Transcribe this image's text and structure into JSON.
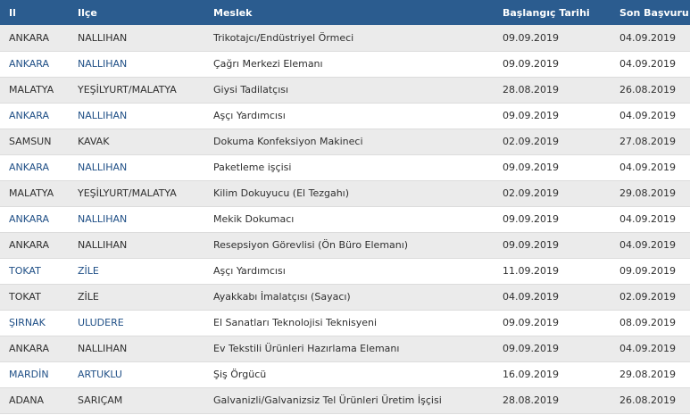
{
  "headers": {
    "il": "Il",
    "ilce": "Ilçe",
    "meslek": "Meslek",
    "baslangic": "Başlangıç Tarihi",
    "son_basvuru": "Son Başvuru"
  },
  "colors": {
    "header_bg": "#2b5c8f",
    "row_alt_bg": "#ebebeb",
    "link_blue": "#1f4f86",
    "text_dark": "#2f2f2f"
  },
  "rows": [
    {
      "il": "ANKARA",
      "ilce": "NALLIHAN",
      "meslek": "Trikotajcı/Endüstriyel Örmeci",
      "baslangic": "09.09.2019",
      "son": "04.09.2019"
    },
    {
      "il": "ANKARA",
      "ilce": "NALLIHAN",
      "meslek": "Çağrı Merkezi Elemanı",
      "baslangic": "09.09.2019",
      "son": "04.09.2019"
    },
    {
      "il": "MALATYA",
      "ilce": "YEŞİLYURT/MALATYA",
      "meslek": "Giysi Tadilatçısı",
      "baslangic": "28.08.2019",
      "son": "26.08.2019"
    },
    {
      "il": "ANKARA",
      "ilce": "NALLIHAN",
      "meslek": "Aşçı Yardımcısı",
      "baslangic": "09.09.2019",
      "son": "04.09.2019"
    },
    {
      "il": "SAMSUN",
      "ilce": "KAVAK",
      "meslek": "Dokuma Konfeksiyon Makineci",
      "baslangic": "02.09.2019",
      "son": "27.08.2019"
    },
    {
      "il": "ANKARA",
      "ilce": "NALLIHAN",
      "meslek": "Paketleme işçisi",
      "baslangic": "09.09.2019",
      "son": "04.09.2019"
    },
    {
      "il": "MALATYA",
      "ilce": "YEŞİLYURT/MALATYA",
      "meslek": "Kilim Dokuyucu (El Tezgahı)",
      "baslangic": "02.09.2019",
      "son": "29.08.2019"
    },
    {
      "il": "ANKARA",
      "ilce": "NALLIHAN",
      "meslek": "Mekik Dokumacı",
      "baslangic": "09.09.2019",
      "son": "04.09.2019"
    },
    {
      "il": "ANKARA",
      "ilce": "NALLIHAN",
      "meslek": "Resepsiyon Görevlisi (Ön Büro Elemanı)",
      "baslangic": "09.09.2019",
      "son": "04.09.2019"
    },
    {
      "il": "TOKAT",
      "ilce": "ZİLE",
      "meslek": "Aşçı Yardımcısı",
      "baslangic": "11.09.2019",
      "son": "09.09.2019"
    },
    {
      "il": "TOKAT",
      "ilce": "ZİLE",
      "meslek": "Ayakkabı İmalatçısı (Sayacı)",
      "baslangic": "04.09.2019",
      "son": "02.09.2019"
    },
    {
      "il": "ŞIRNAK",
      "ilce": "ULUDERE",
      "meslek": "El Sanatları Teknolojisi Teknisyeni",
      "baslangic": "09.09.2019",
      "son": "08.09.2019"
    },
    {
      "il": "ANKARA",
      "ilce": "NALLIHAN",
      "meslek": "Ev Tekstili Ürünleri Hazırlama Elemanı",
      "baslangic": "09.09.2019",
      "son": "04.09.2019"
    },
    {
      "il": "MARDİN",
      "ilce": "ARTUKLU",
      "meslek": "Şiş Örgücü",
      "baslangic": "16.09.2019",
      "son": "29.08.2019"
    },
    {
      "il": "ADANA",
      "ilce": "SARIÇAM",
      "meslek": "Galvanizli/Galvanizsiz Tel Ürünleri Üretim İşçisi",
      "baslangic": "28.08.2019",
      "son": "26.08.2019"
    }
  ]
}
